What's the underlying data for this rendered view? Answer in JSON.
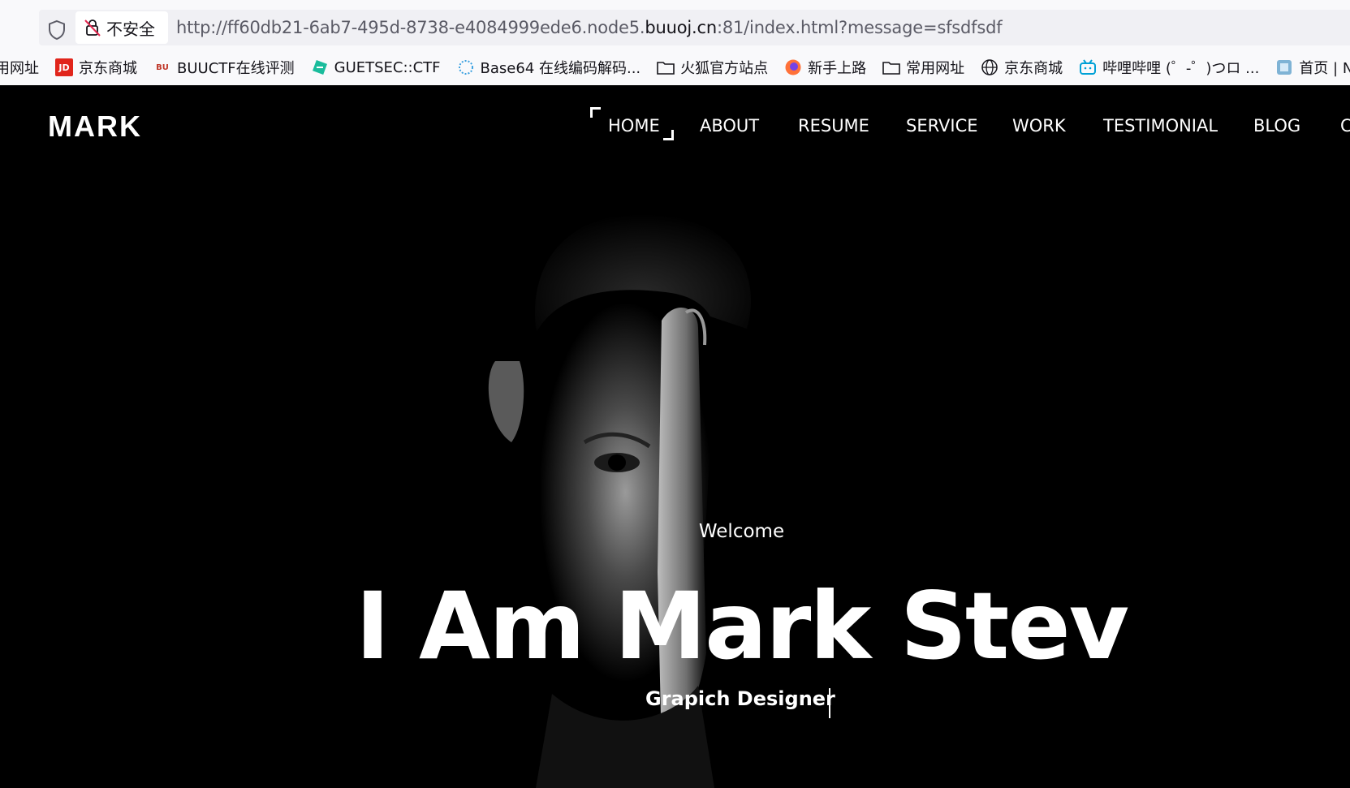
{
  "browser": {
    "security_label": "不安全",
    "url_prefix": "http://ff60db21-6ab7-495d-8738-e4084999ede6.node5.",
    "url_domain": "buuoj.cn",
    "url_suffix": ":81/index.html?message=sfsdfsdf",
    "bookmarks": [
      {
        "label": "用网址",
        "icon": "partial-icon"
      },
      {
        "label": "京东商城",
        "icon": "jd-icon"
      },
      {
        "label": "BUUCTF在线评测",
        "icon": "buuctf-icon"
      },
      {
        "label": "GUETSEC::CTF",
        "icon": "guetsec-icon"
      },
      {
        "label": "Base64 在线编码解码...",
        "icon": "base64-icon"
      },
      {
        "label": "火狐官方站点",
        "icon": "folder-icon"
      },
      {
        "label": "新手上路",
        "icon": "firefox-icon"
      },
      {
        "label": "常用网址",
        "icon": "folder-icon"
      },
      {
        "label": "京东商城",
        "icon": "globe-icon"
      },
      {
        "label": "哔哩哔哩 (゜-゜)つロ ...",
        "icon": "bilibili-icon"
      },
      {
        "label": "首页 | NSSCTF",
        "icon": "nss-icon"
      }
    ]
  },
  "site": {
    "logo": "MARK",
    "nav": {
      "home": "HOME",
      "about": "ABOUT",
      "resume": "RESUME",
      "service": "SERVICE",
      "work": "WORK",
      "testimonial": "TESTIMONIAL",
      "blog": "BLOG",
      "contact": "CONTACT"
    },
    "hero": {
      "welcome": "Welcome",
      "headline": "I Am Mark Stev",
      "role": "Grapich Designer"
    }
  },
  "colors": {
    "background": "#000000",
    "text": "#ffffff",
    "browser_bg": "#f9f9fb"
  }
}
